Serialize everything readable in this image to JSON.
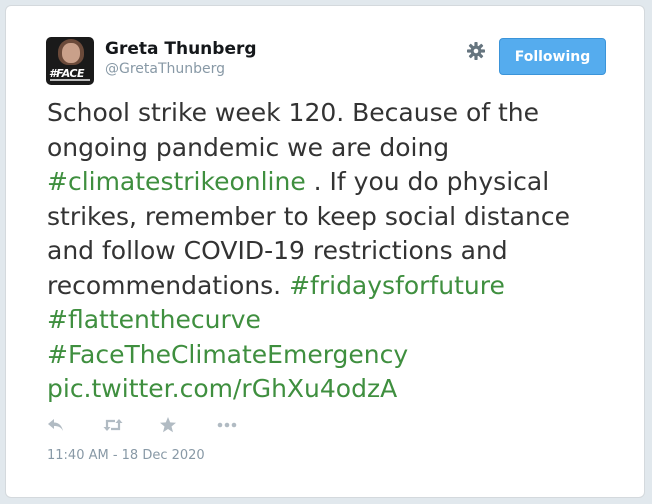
{
  "user": {
    "display_name": "Greta Thunberg",
    "handle": "@GretaThunberg",
    "avatar_text": "#FACE"
  },
  "follow_button": {
    "label": "Following"
  },
  "tweet": {
    "line1": "School strike week 120. Because of the ongoing pandemic we are doing",
    "hashtag_climatestrikeonline": "#climatestrikeonline",
    "line2": " . If you do physical strikes, remember to keep social distance and follow COVID-19 restrictions and recommendations.",
    "hashtag_fridaysforfuture": "#fridaysforfuture",
    "hashtag_flattenthecurve": "#flattenthecurve",
    "hashtag_facetheclimateemergency": "#FaceTheClimateEmergency",
    "pic_link": "pic.twitter.com/rGhXu4odzA"
  },
  "timestamp": "11:40 AM - 18 Dec 2020",
  "icons": {
    "reply": "reply-icon",
    "retweet": "retweet-icon",
    "like": "star-icon",
    "more": "more-icon",
    "settings": "gear-icon"
  },
  "colors": {
    "link": "#3f8f3f",
    "button": "#55acee",
    "muted": "#8899a6",
    "text": "#333333"
  }
}
